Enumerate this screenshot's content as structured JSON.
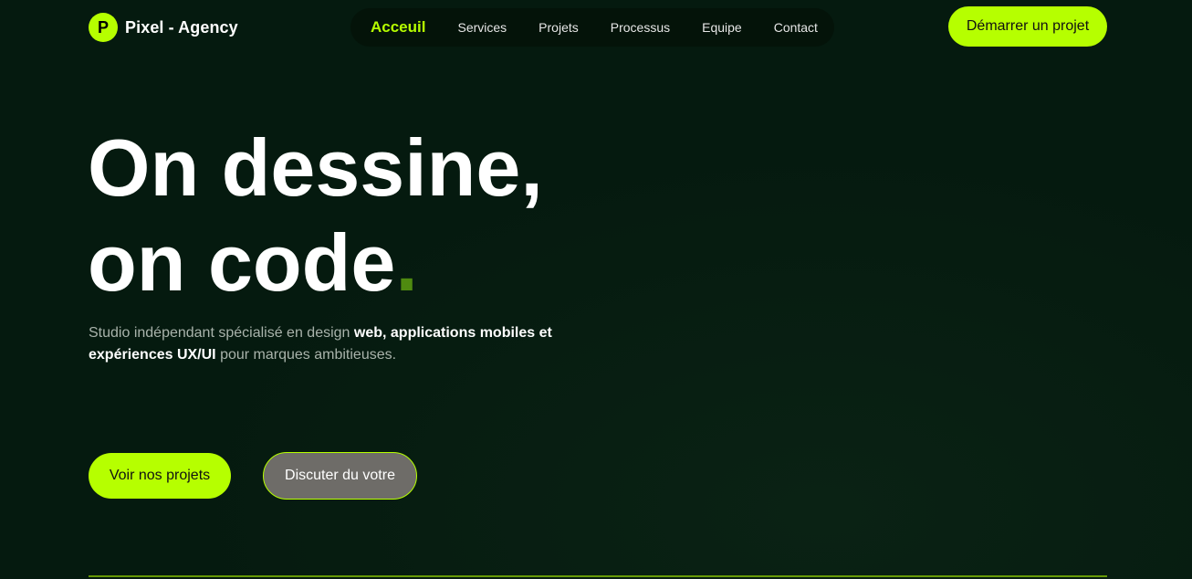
{
  "header": {
    "logo_letter": "P",
    "brand_name": "Pixel - Agency",
    "nav": [
      {
        "label": "Acceuil",
        "active": true
      },
      {
        "label": "Services",
        "active": false
      },
      {
        "label": "Projets",
        "active": false
      },
      {
        "label": "Processus",
        "active": false
      },
      {
        "label": "Equipe",
        "active": false
      },
      {
        "label": "Contact",
        "active": false
      }
    ],
    "cta_label": "Démarrer un projet"
  },
  "hero": {
    "title_line1": "On dessine,",
    "title_line2": "on code",
    "title_dot": ".",
    "desc_part1": "Studio indépendant spécialisé en design ",
    "desc_bold1": "web, applications mobiles et expériences UX/UI",
    "desc_part2": " pour marques ambitieuses.",
    "primary_button": "Voir nos projets",
    "secondary_button": "Discuter du votre"
  },
  "colors": {
    "background": "#051a0f",
    "accent": "#b6ff00",
    "nav_bg": "#041309",
    "secondary_button_bg": "#6e6c68",
    "title_dot": "#4f8a10"
  }
}
